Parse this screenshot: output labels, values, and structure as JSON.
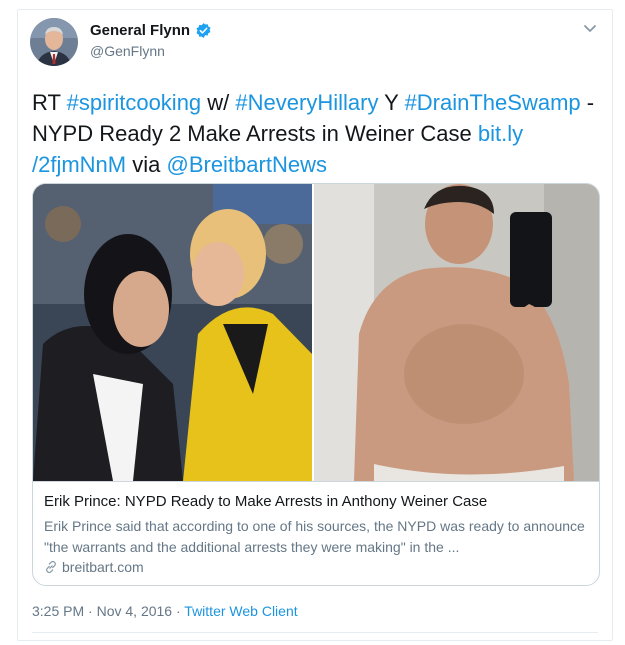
{
  "user": {
    "name": "General Flynn",
    "handle": "@GenFlynn",
    "verified_icon": "verified-badge-icon"
  },
  "tweet": {
    "segments": [
      {
        "text": "RT ",
        "link": false
      },
      {
        "text": "#spiritcooking",
        "link": true
      },
      {
        "text": " w/ ",
        "link": false
      },
      {
        "text": "#NeveryHillary",
        "link": true
      },
      {
        "text": " Y ",
        "link": false
      },
      {
        "text": "#DrainTheSwamp",
        "link": true
      },
      {
        "text": " - NYPD Ready 2 Make Arrests in Weiner Case ",
        "link": false
      },
      {
        "text": "bit.ly /2fjmNnM",
        "link": true
      },
      {
        "text": " via ",
        "link": false
      },
      {
        "text": "@BreitbartNews",
        "link": true
      }
    ]
  },
  "link_card": {
    "title": "Erik Prince: NYPD Ready to Make Arrests in Anthony Weiner Case",
    "description": "Erik Prince said that according to one of his sources, the NYPD was ready to announce \"the warrants and the additional arrests they were making\" in the ...",
    "domain": "breitbart.com"
  },
  "meta": {
    "time": "3:25 PM",
    "sep1": " · ",
    "date": "Nov 4, 2016",
    "sep2": " · ",
    "source": "Twitter Web Client"
  },
  "colors": {
    "link": "#1b95e0",
    "secondary_text": "#657786",
    "border": "#ccd6dd"
  }
}
